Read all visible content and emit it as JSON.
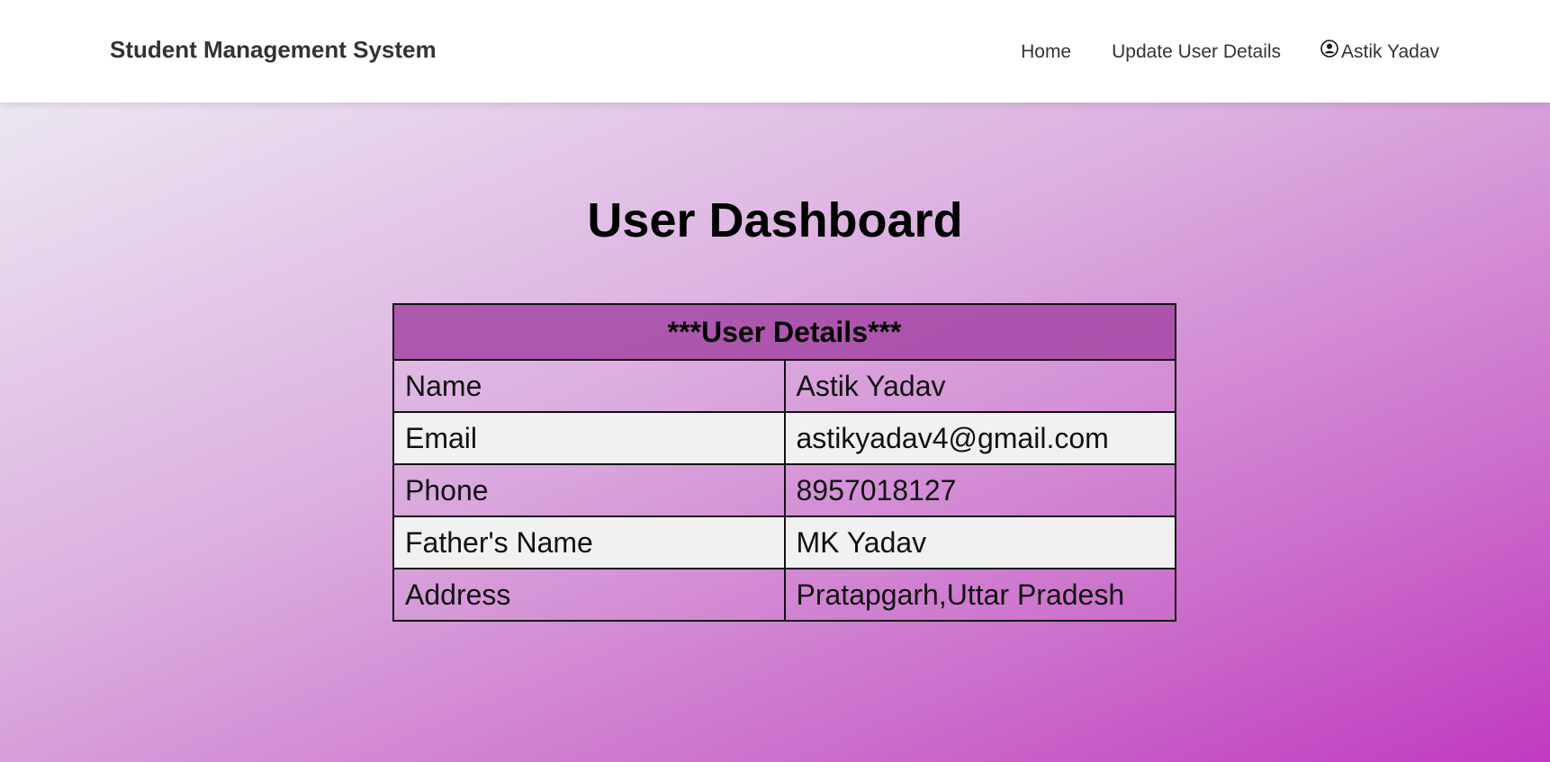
{
  "navbar": {
    "brand": "Student Management System",
    "links": {
      "home": "Home",
      "update": "Update User Details",
      "user": "Astik Yadav"
    },
    "user_icon": "user-circle-icon"
  },
  "main": {
    "title": "User Dashboard",
    "table": {
      "header": "***User Details***",
      "rows": [
        {
          "label": "Name",
          "value": "Astik Yadav"
        },
        {
          "label": "Email",
          "value": "astikyadav4@gmail.com"
        },
        {
          "label": "Phone",
          "value": "8957018127"
        },
        {
          "label": "Father's Name",
          "value": "MK Yadav"
        },
        {
          "label": "Address",
          "value": "Pratapgarh,Uttar Pradesh"
        }
      ]
    }
  },
  "colors": {
    "header_bg": "#a546a5",
    "stripe_bg": "#f1f1f1",
    "gradient_start": "#ece6f2",
    "gradient_end": "#c03ac0"
  }
}
